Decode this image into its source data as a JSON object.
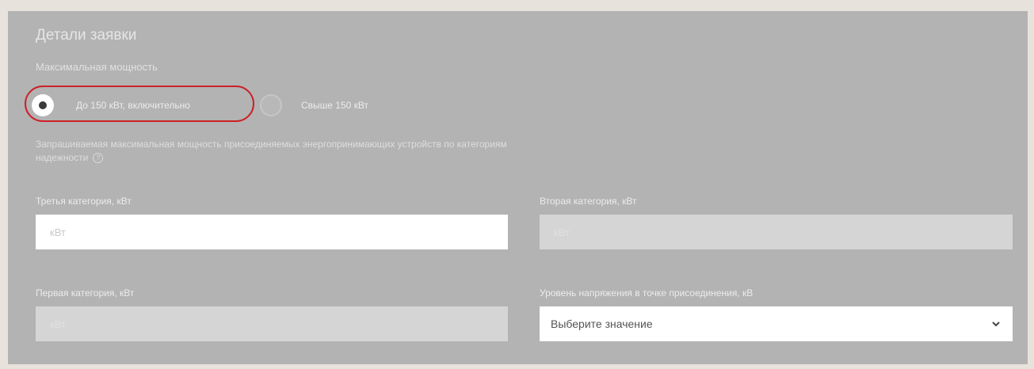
{
  "section": {
    "title": "Детали заявки",
    "subtitle": "Максимальная мощность"
  },
  "power_options": [
    {
      "label": "До 150 кВт, включительно",
      "selected": true
    },
    {
      "label": "Свыше 150 кВт",
      "selected": false
    }
  ],
  "description": "Запрашиваемая максимальная мощность присоединяемых энергопринимающих устройств по категориям надежности",
  "info_icon": {
    "glyph": "?"
  },
  "fields": {
    "third": {
      "label": "Третья категория, кВт",
      "placeholder": "кВт",
      "value": "",
      "enabled": true
    },
    "second": {
      "label": "Вторая категория, кВт",
      "placeholder": "кВт",
      "value": "",
      "enabled": false
    },
    "first": {
      "label": "Первая категория, кВт",
      "placeholder": "кВт",
      "value": "",
      "enabled": false
    },
    "voltage": {
      "label": "Уровень напряжения в точке присоединения, кВ",
      "selected_value": "Выберите значение"
    }
  },
  "icons": {
    "info": "question-circle-icon",
    "dropdown": "chevron-down-icon"
  },
  "colors": {
    "highlight": "#cc2026",
    "panel_background": "#b3b3b3",
    "page_background": "#e7e3dc"
  }
}
